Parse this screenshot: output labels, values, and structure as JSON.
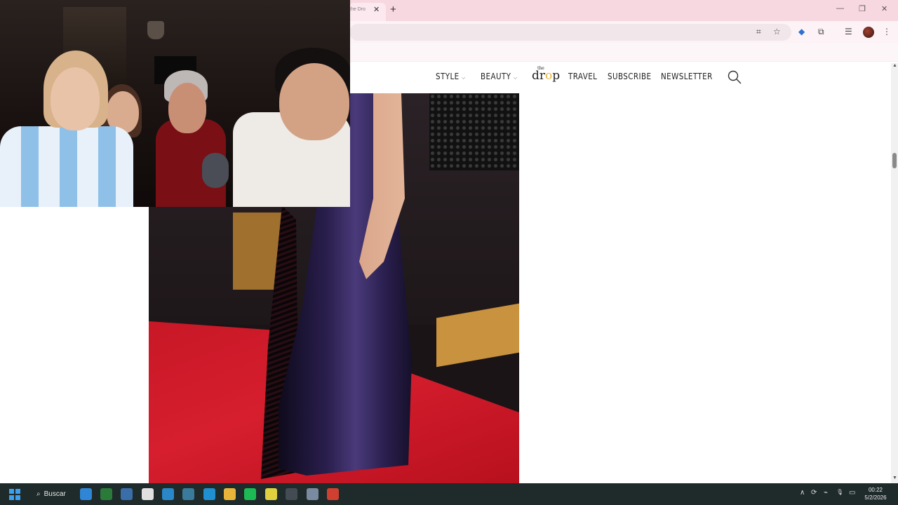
{
  "browser": {
    "tab_title": "the Dro",
    "tab_close": "✕",
    "new_tab": "+",
    "window_controls": {
      "minimize": "—",
      "restore": "❐",
      "close": "✕"
    },
    "toolbar_icons": [
      "translate-icon",
      "star-icon",
      "extension-blue-icon",
      "extensions-icon",
      "reading-list-icon",
      "profile-avatar",
      "menu-icon"
    ]
  },
  "site": {
    "nav": [
      {
        "label": "STYLE",
        "has_dropdown": true
      },
      {
        "label": "BEAUTY",
        "has_dropdown": true
      },
      {
        "label": "TRAVEL",
        "has_dropdown": false
      },
      {
        "label": "SUBSCRIBE",
        "has_dropdown": false
      },
      {
        "label": "NEWSLETTER",
        "has_dropdown": false
      }
    ],
    "logo": {
      "the": "the",
      "text_a": "dr",
      "text_o": "o",
      "text_b": "p"
    },
    "dropdown_chevron": "⌵"
  },
  "taskbar": {
    "search_label": "Buscar",
    "search_icon": "⌕",
    "apps": [
      {
        "name": "maps",
        "color": "#2f86d6"
      },
      {
        "name": "store",
        "color": "#2a7a3a"
      },
      {
        "name": "calculator",
        "color": "#3a6ea8"
      },
      {
        "name": "office",
        "color": "#e0e0e0"
      },
      {
        "name": "notepad",
        "color": "#2a88c8"
      },
      {
        "name": "network",
        "color": "#3a7a9a"
      },
      {
        "name": "edge",
        "color": "#1f8fd0"
      },
      {
        "name": "explorer",
        "color": "#e8b53a"
      },
      {
        "name": "spotify",
        "color": "#1db954"
      },
      {
        "name": "chrome",
        "color": "#e0d040"
      },
      {
        "name": "obs",
        "color": "#444b52"
      },
      {
        "name": "settings",
        "color": "#7a8aa0"
      },
      {
        "name": "chrome-active",
        "color": "#d04030"
      }
    ],
    "tray": {
      "chevron": "∧",
      "icons": [
        "⟳",
        "⌁",
        "🎙",
        "▭",
        "🔊"
      ]
    },
    "time": "00:22",
    "date": "5/2/2026"
  },
  "scrollbar": {
    "up": "▲",
    "down": "▼"
  }
}
